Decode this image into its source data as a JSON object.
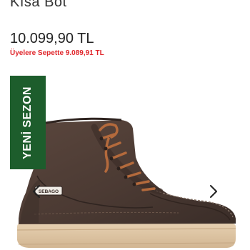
{
  "product": {
    "title": "Kısa Bot",
    "price": "10.099,90 TL",
    "member_price": "Üyelere Sepette 9.089,91 TL"
  },
  "gallery": {
    "badge_text": "YENİ SEZON",
    "brand_tag_text": "SEBAGO",
    "icons": {
      "prev": "chevron-left-icon",
      "next": "chevron-right-icon"
    }
  },
  "colors": {
    "member_price": "#e0262b",
    "badge_bg": "#1d5d2c",
    "boot_suede": "#4b3a33",
    "sole": "#dcc3a3",
    "laces": "#b46a3c"
  }
}
